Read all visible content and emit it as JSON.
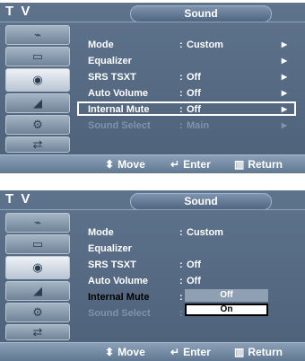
{
  "screen1": {
    "tv_label": "T V",
    "title": "Sound",
    "items": [
      {
        "label": "Mode",
        "value": "Custom",
        "arrow": "▶"
      },
      {
        "label": "Equalizer",
        "value": "",
        "arrow": "▶"
      },
      {
        "label": "SRS TSXT",
        "value": "Off",
        "arrow": "▶"
      },
      {
        "label": "Auto Volume",
        "value": "Off",
        "arrow": "▶"
      },
      {
        "label": "Internal Mute",
        "value": "Off",
        "arrow": "▶"
      },
      {
        "label": "Sound Select",
        "value": "Main",
        "arrow": "▶"
      }
    ],
    "footer": {
      "move": "Move",
      "enter": "Enter",
      "return": "Return"
    }
  },
  "screen2": {
    "tv_label": "T V",
    "title": "Sound",
    "items": [
      {
        "label": "Mode",
        "value": "Custom"
      },
      {
        "label": "Equalizer",
        "value": ""
      },
      {
        "label": "SRS TSXT",
        "value": "Off"
      },
      {
        "label": "Auto Volume",
        "value": "Off"
      },
      {
        "label": "Internal Mute",
        "value": ""
      },
      {
        "label": "Sound Select",
        "value": ""
      }
    ],
    "dropdown": {
      "options": [
        "Off",
        "On"
      ],
      "selected": "On"
    },
    "footer": {
      "move": "Move",
      "enter": "Enter",
      "return": "Return"
    }
  },
  "icons": {
    "sidebar": [
      "antenna-icon",
      "picture-icon",
      "speaker-icon",
      "channel-icon",
      "setup-icon",
      "input-icon"
    ],
    "move": "updown-icon",
    "enter": "enter-icon",
    "return": "return-icon"
  }
}
